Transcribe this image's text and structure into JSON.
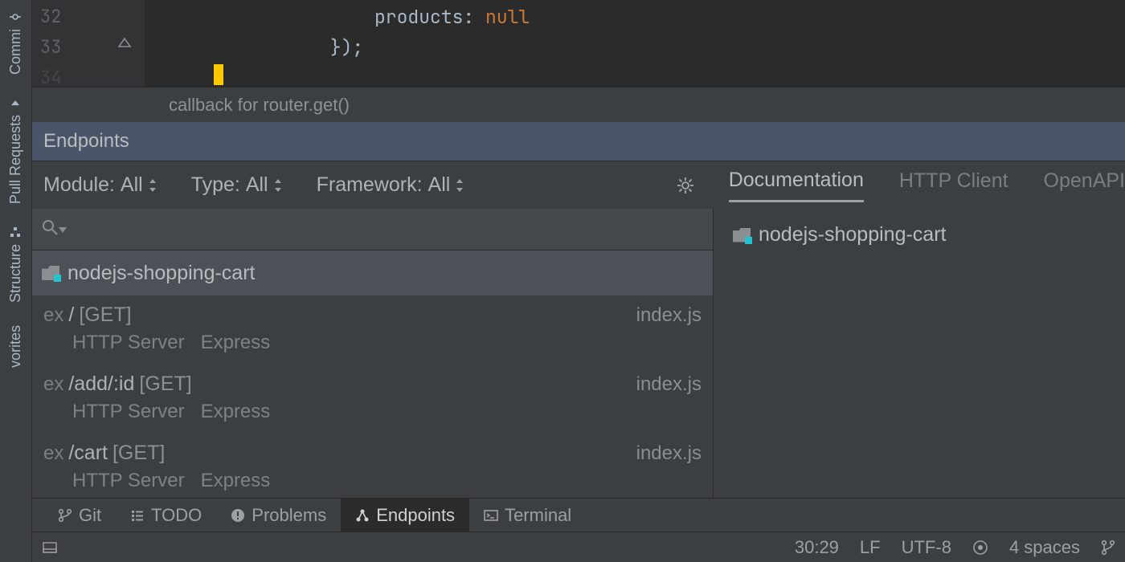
{
  "sidebar": {
    "items": [
      {
        "label": "Commi"
      },
      {
        "label": "Pull Requests"
      },
      {
        "label": "Structure"
      },
      {
        "label": "vorites"
      }
    ]
  },
  "editor": {
    "lines": [
      {
        "num": "32",
        "indent": "                    ",
        "prop": "products: ",
        "val": "null"
      },
      {
        "num": "33",
        "indent": "                ",
        "text": "});"
      },
      {
        "num": "34"
      }
    ]
  },
  "breadcrumb": "callback for router.get()",
  "toolwindow_title": "Endpoints",
  "filters": {
    "module": {
      "label": "Module:",
      "value": "All"
    },
    "type": {
      "label": "Type:",
      "value": "All"
    },
    "fw": {
      "label": "Framework:",
      "value": "All"
    }
  },
  "project_name": "nodejs-shopping-cart",
  "endpoints": [
    {
      "prefix": "ex",
      "path": "/",
      "method": "[GET]",
      "file": "index.js",
      "server": "HTTP Server",
      "framework": "Express"
    },
    {
      "prefix": "ex",
      "path": "/add/:id",
      "method": "[GET]",
      "file": "index.js",
      "server": "HTTP Server",
      "framework": "Express"
    },
    {
      "prefix": "ex",
      "path": "/cart",
      "method": "[GET]",
      "file": "index.js",
      "server": "HTTP Server",
      "framework": "Express"
    }
  ],
  "doc_tabs": [
    "Documentation",
    "HTTP Client",
    "OpenAPI"
  ],
  "doc_active": 0,
  "doc_project": "nodejs-shopping-cart",
  "bottom_tabs": [
    {
      "label": "Git"
    },
    {
      "label": "TODO"
    },
    {
      "label": "Problems"
    },
    {
      "label": "Endpoints",
      "active": true
    },
    {
      "label": "Terminal"
    }
  ],
  "status": {
    "cursor": "30:29",
    "line_sep": "LF",
    "encoding": "UTF-8",
    "indent": "4 spaces"
  }
}
